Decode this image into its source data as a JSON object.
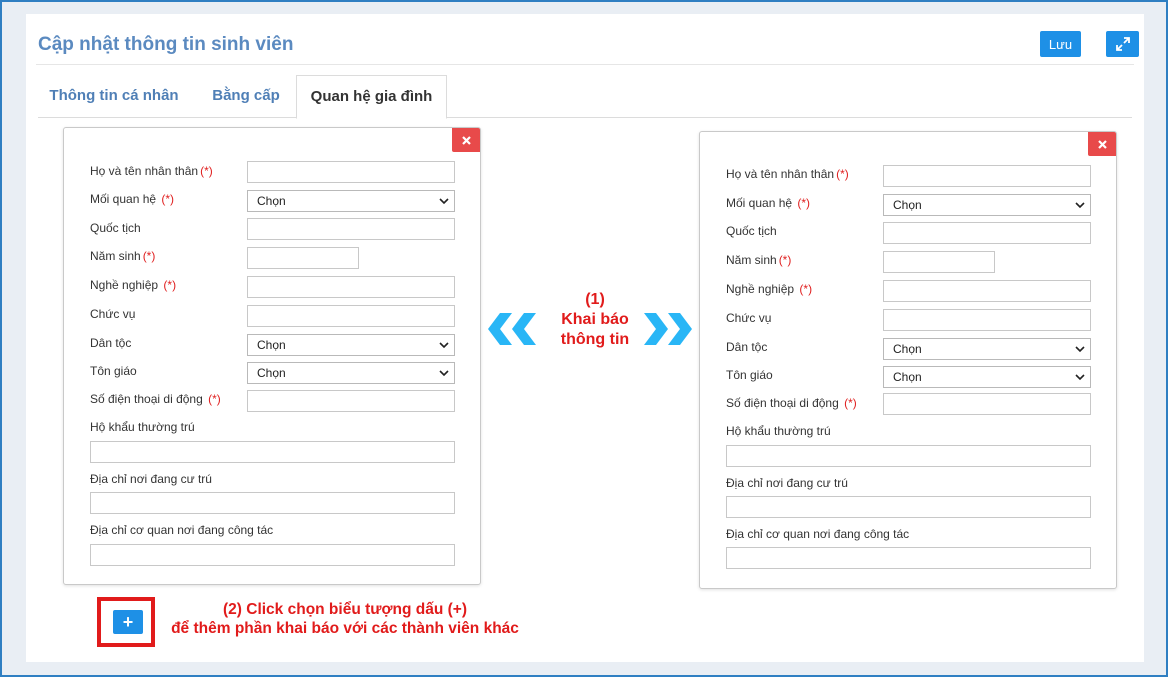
{
  "header": {
    "title": "Cập nhật thông tin sinh viên",
    "save_label": "Lưu",
    "expand_icon": "expand-icon"
  },
  "tabs": [
    {
      "label": "Thông tin cá nhân",
      "active": false
    },
    {
      "label": "Bằng cấp",
      "active": false
    },
    {
      "label": "Quan hệ gia đình",
      "active": true
    }
  ],
  "form": {
    "fields": {
      "full_name": "Họ và tên nhân thân",
      "relationship": "Mối quan hệ",
      "nationality": "Quốc tịch",
      "birth_year": "Năm sinh",
      "occupation": "Nghề nghiệp",
      "position": "Chức vụ",
      "ethnicity": "Dân tộc",
      "religion": "Tôn giáo",
      "phone": "Số điện thoại di động",
      "household": "Hộ khẩu thường trú",
      "residence": "Địa chỉ nơi đang cư trú",
      "workplace": "Địa chỉ cơ quan nơi đang công tác"
    },
    "required_mark": "(*)",
    "select_default": "Chọn"
  },
  "annotations": {
    "middle_line1": "(1)",
    "middle_line2": "Khai báo",
    "middle_line3": "thông tin",
    "note_line1": "(2) Click chọn biểu tượng dấu (+)",
    "note_line2": "để thêm phần khai báo với các thành viên khác",
    "add_label": "+"
  },
  "colors": {
    "primary": "#1e90e6",
    "danger": "#e84a4a",
    "annotation": "#e11b1b",
    "arrow": "#29b6f6",
    "title": "#5b8ac0"
  }
}
